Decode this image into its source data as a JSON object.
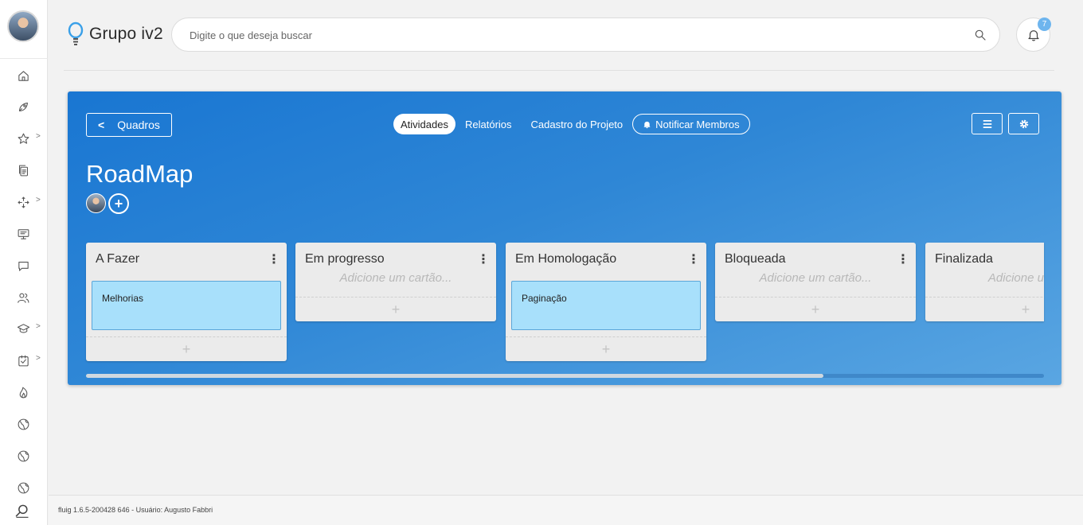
{
  "header": {
    "logo_text": "Grupo iv2",
    "search_placeholder": "Digite o que deseja buscar",
    "notification_count": "7"
  },
  "board": {
    "back_label": "Quadros",
    "title": "RoadMap",
    "tabs": [
      {
        "label": "Atividades",
        "active": true
      },
      {
        "label": "Relatórios",
        "active": false
      },
      {
        "label": "Cadastro do Projeto",
        "active": false
      },
      {
        "label": "Notificar Membros",
        "active": false
      }
    ],
    "lists": [
      {
        "title": "A Fazer",
        "cards": [
          "Melhorias"
        ],
        "placeholder": ""
      },
      {
        "title": "Em progresso",
        "cards": [],
        "placeholder": "Adicione um cartão..."
      },
      {
        "title": "Em Homologação",
        "cards": [
          "Paginação"
        ],
        "placeholder": ""
      },
      {
        "title": "Bloqueada",
        "cards": [],
        "placeholder": "Adicione um cartão..."
      },
      {
        "title": "Finalizada",
        "cards": [],
        "placeholder": "Adicione um c"
      }
    ],
    "scroll_fraction": 0.77
  },
  "icons": {
    "nav": [
      "home-icon",
      "rocket-icon",
      "star-icon",
      "documents-icon",
      "workflow-icon",
      "presentation-icon",
      "chat-icon",
      "users-icon",
      "graduation-icon",
      "checklist-icon",
      "fire-icon",
      "globe-icon",
      "globe-icon",
      "globe-icon"
    ],
    "add_card": "plus-icon",
    "list_menu": "kebab-icon"
  },
  "footer": {
    "text": "fluig 1.6.5-200428 646 - Usuário: Augusto Fabbri"
  },
  "colors": {
    "board_gradient_start": "#1976d2",
    "board_gradient_end": "#5aa6e2",
    "card_bg": "#a8e0fb",
    "badge": "#6eb5ee"
  }
}
